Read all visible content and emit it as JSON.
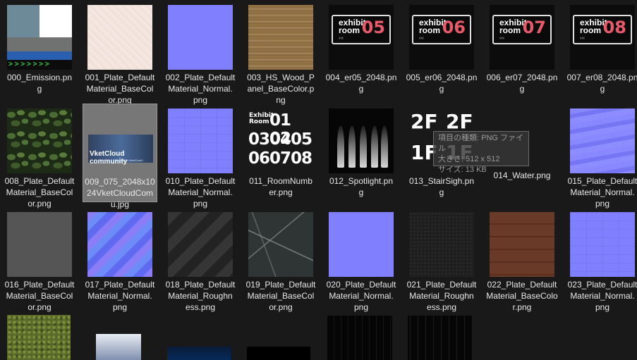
{
  "files": [
    {
      "name": "000_Emission.png"
    },
    {
      "name": "001_Plate_DefaultMaterial_BaseColor.png"
    },
    {
      "name": "002_Plate_DefaultMaterial_Normal.png"
    },
    {
      "name": "003_HS_Wood_Panel_BaseColor.png"
    },
    {
      "name": "004_er05_2048.png",
      "label": "exhibit\nroom",
      "number": "05"
    },
    {
      "name": "005_er06_2048.png",
      "label": "exhibit\nroom",
      "number": "06"
    },
    {
      "name": "006_er07_2048.png",
      "label": "exhibit\nroom",
      "number": "07"
    },
    {
      "name": "007_er08_2048.png",
      "label": "exhibit\nroom",
      "number": "08"
    },
    {
      "name": "008_Plate_DefaultMaterial_BaseColor.png"
    },
    {
      "name": "009_075_2048x1024VketCloudComu.jpg",
      "banner_title": "VketCloud community",
      "banner_sub": "Look at on VketCloud !"
    },
    {
      "name": "010_Plate_DefaultMaterial_Normal.png"
    },
    {
      "name": "011_RoomNumber.png",
      "header": "Exhibit Room",
      "rows": [
        "01 02",
        "030405",
        "060708"
      ]
    },
    {
      "name": "012_Spotlight.png"
    },
    {
      "name": "013_StairSigh.png",
      "labels": [
        "2F",
        "2F",
        "1F",
        "1F"
      ]
    },
    {
      "name": "014_Water.png"
    },
    {
      "name": "015_Plate_DefaultMaterial_Normal.png"
    },
    {
      "name": "016_Plate_DefaultMaterial_BaseColor.png"
    },
    {
      "name": "017_Plate_DefaultMaterial_Normal.png"
    },
    {
      "name": "018_Plate_DefaultMaterial_Roughness.png"
    },
    {
      "name": "019_Plate_DefaultMaterial_BaseColor.png"
    },
    {
      "name": "020_Plate_DefaultMaterial_Normal.png"
    },
    {
      "name": "021_Plate_DefaultMaterial_Roughness.png"
    },
    {
      "name": "022_Plate_DefaultMaterial_BaseColor.png"
    },
    {
      "name": "023_Plate_DefaultMaterial_Normal.png"
    }
  ],
  "captions": [
    [
      "000_Emission.pn",
      "g"
    ],
    [
      "001_Plate_Default",
      "Material_BaseCol",
      "or.png"
    ],
    [
      "002_Plate_Default",
      "Material_Normal.",
      "png"
    ],
    [
      "003_HS_Wood_P",
      "anel_BaseColor.p",
      "ng"
    ],
    [
      "004_er05_2048.pn",
      "g"
    ],
    [
      "005_er06_2048.pn",
      "g"
    ],
    [
      "006_er07_2048.pn",
      "g"
    ],
    [
      "007_er08_2048.pn",
      "g"
    ],
    [
      "008_Plate_Default",
      "Material_BaseCol",
      "or.png"
    ],
    [
      "009_075_2048x10",
      "24VketCloudCom",
      "u.jpg"
    ],
    [
      "010_Plate_Default",
      "Material_Normal.",
      "png"
    ],
    [
      "011_RoomNumb",
      "er.png"
    ],
    [
      "012_Spotlight.pn",
      "g"
    ],
    [
      "013_StairSigh.pn",
      "g"
    ],
    [
      "014_Water.png"
    ],
    [
      "015_Plate_Default",
      "Material_Normal.",
      "png"
    ],
    [
      "016_Plate_Default",
      "Material_BaseCol",
      "or.png"
    ],
    [
      "017_Plate_Default",
      "Material_Normal.",
      "png"
    ],
    [
      "018_Plate_Default",
      "Material_Roughn",
      "ess.png"
    ],
    [
      "019_Plate_Default",
      "Material_BaseCol",
      "or.png"
    ],
    [
      "020_Plate_Default",
      "Material_Normal.",
      "png"
    ],
    [
      "021_Plate_Default",
      "Material_Roughn",
      "ess.png"
    ],
    [
      "022_Plate_Default",
      "Material_BaseColo",
      "r.png"
    ],
    [
      "023_Plate_Default",
      "Material_Normal.",
      "png"
    ]
  ],
  "tooltip": {
    "line1": "項目の種類: PNG ファイル",
    "line2": "大きさ: 512 x 512",
    "line3": "サイズ: 13 KB"
  },
  "selected_index": 9,
  "colors": {
    "background": "#191919",
    "selected": "#777777",
    "exhibit_number": "#e85a6a",
    "normal_map": "#8080ff"
  }
}
